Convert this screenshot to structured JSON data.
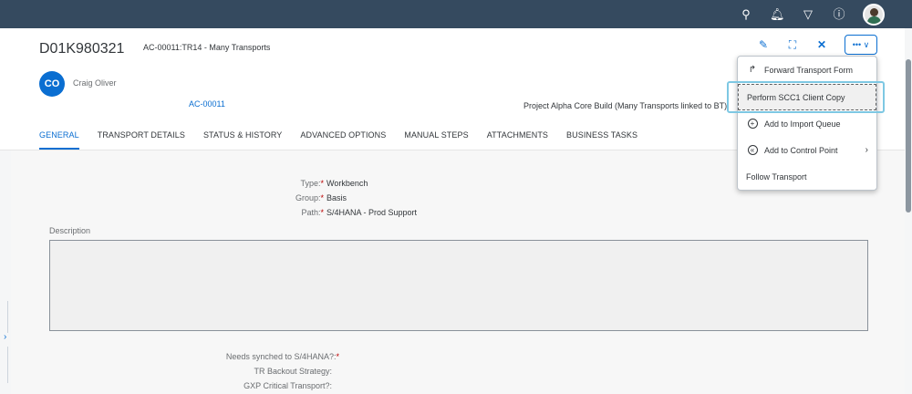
{
  "shell": {
    "icons": [
      "search-icon",
      "notification-icon",
      "filter-icon",
      "help-icon",
      "user-avatar"
    ]
  },
  "header": {
    "title": "D01K980321",
    "subtitle": "AC-00011:TR14 - Many Transports",
    "owner_initials": "CO",
    "owner_name": "Craig Oliver",
    "link": "AC-00011",
    "description": "Project Alpha Core Build (Many Transports linked to BT)",
    "more_label": "••• ∨"
  },
  "tabs": [
    {
      "label": "GENERAL",
      "active": true
    },
    {
      "label": "TRANSPORT DETAILS",
      "active": false
    },
    {
      "label": "STATUS & HISTORY",
      "active": false
    },
    {
      "label": "ADVANCED OPTIONS",
      "active": false
    },
    {
      "label": "MANUAL STEPS",
      "active": false
    },
    {
      "label": "ATTACHMENTS",
      "active": false
    },
    {
      "label": "BUSINESS TASKS",
      "active": false
    }
  ],
  "form": {
    "type_label": "Type:",
    "type_value": "Workbench",
    "group_label": "Group:",
    "group_value": "Basis",
    "path_label": "Path:",
    "path_value": "S/4HANA - Prod Support",
    "description_label": "Description",
    "synched_label": "Needs synched to S/4HANA?:",
    "backout_label": "TR Backout Strategy:",
    "gxp_label": "GXP Critical Transport?:",
    "required_mark": "*"
  },
  "menu": {
    "items": [
      {
        "label": "Forward Transport Form",
        "icon": "forward-icon"
      },
      {
        "label": "Perform SCC1 Client Copy",
        "icon": ""
      },
      {
        "label": "Add to Import Queue",
        "icon": "add-circle-icon"
      },
      {
        "label": "Add to Control Point",
        "icon": "control-point-icon"
      },
      {
        "label": "Follow Transport",
        "icon": ""
      }
    ]
  },
  "colors": {
    "shell": "#354a5f",
    "accent": "#0a6ed1",
    "required": "#bb0000"
  }
}
